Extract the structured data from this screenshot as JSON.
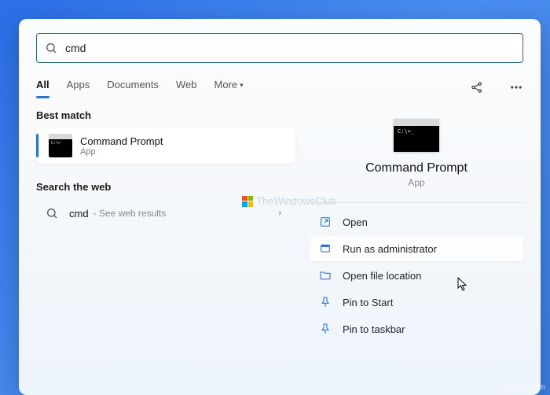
{
  "search": {
    "query": "cmd"
  },
  "tabs": {
    "all": "All",
    "apps": "Apps",
    "documents": "Documents",
    "web": "Web",
    "more": "More"
  },
  "sections": {
    "best_match": "Best match",
    "search_web": "Search the web"
  },
  "best_match": {
    "title": "Command Prompt",
    "subtitle": "App"
  },
  "web": {
    "term": "cmd",
    "hint": "- See web results"
  },
  "watermark": "TheWindowsClub",
  "detail": {
    "title": "Command Prompt",
    "subtitle": "App",
    "actions": {
      "open": "Open",
      "run_admin": "Run as administrator",
      "open_location": "Open file location",
      "pin_start": "Pin to Start",
      "pin_taskbar": "Pin to taskbar"
    }
  },
  "source_watermark": "wsxdn.com"
}
